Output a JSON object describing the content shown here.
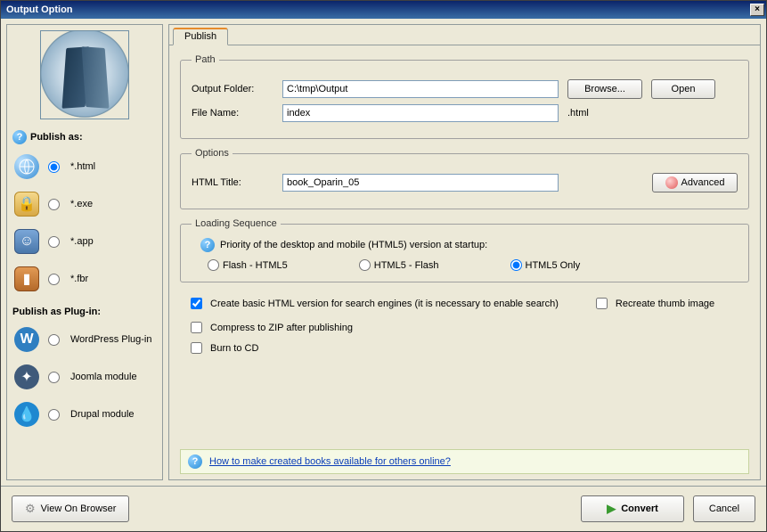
{
  "window": {
    "title": "Output Option"
  },
  "sidebar": {
    "publish_as_heading": "Publish as:",
    "plugin_heading": "Publish as Plug-in:",
    "options": {
      "html": "*.html",
      "exe": "*.exe",
      "app": "*.app",
      "fbr": "*.fbr",
      "wp": "WordPress Plug-in",
      "joomla": "Joomla module",
      "drupal": "Drupal module"
    }
  },
  "tabs": {
    "publish": "Publish"
  },
  "path": {
    "legend": "Path",
    "output_folder_label": "Output Folder:",
    "output_folder_value": "C:\\tmp\\Output",
    "browse_label": "Browse...",
    "open_label": "Open",
    "file_name_label": "File Name:",
    "file_name_value": "index",
    "file_name_suffix": ".html"
  },
  "options_group": {
    "legend": "Options",
    "html_title_label": "HTML Title:",
    "html_title_value": "book_Oparin_05",
    "advanced_label": "Advanced"
  },
  "loading": {
    "legend": "Loading Sequence",
    "priority_text": "Priority of the desktop and mobile (HTML5) version at startup:",
    "opt_flash_html5": "Flash - HTML5",
    "opt_html5_flash": "HTML5 - Flash",
    "opt_html5_only": "HTML5 Only"
  },
  "checks": {
    "basic_html": "Create basic HTML version for search engines (it is necessary to enable search)",
    "recreate_thumb": "Recreate thumb image",
    "zip": "Compress to ZIP after publishing",
    "burn": "Burn to CD"
  },
  "info": {
    "link_text": "How to make created books available for others online?"
  },
  "footer": {
    "view_label": "View On Browser",
    "convert_label": "Convert",
    "cancel_label": "Cancel"
  }
}
